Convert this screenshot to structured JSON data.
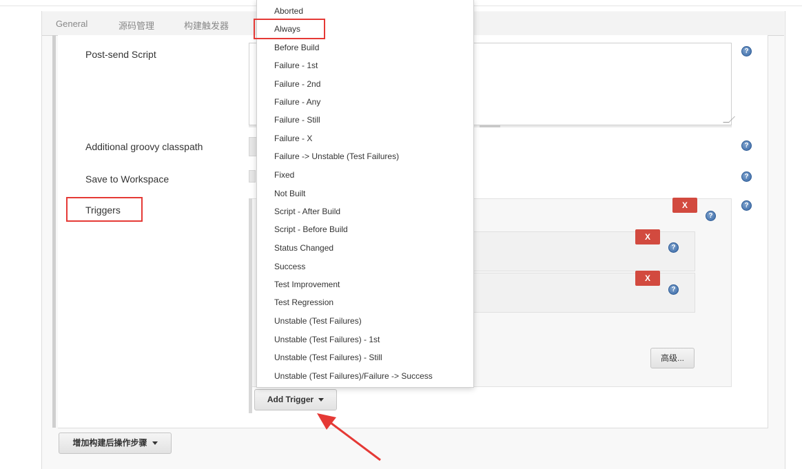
{
  "tabs": [
    "General",
    "源码管理",
    "构建触发器"
  ],
  "fields": {
    "post_send_script": "Post-send Script",
    "groovy_classpath": "Additional groovy classpath",
    "save_workspace": "Save to Workspace",
    "triggers": "Triggers"
  },
  "buttons": {
    "delete": "X",
    "advanced": "高级...",
    "add_trigger": "Add Trigger",
    "add_post_build": "增加构建后操作步骤"
  },
  "help_glyph": "?",
  "dropdown": {
    "items": [
      "Aborted",
      "Always",
      "Before Build",
      "Failure - 1st",
      "Failure - 2nd",
      "Failure - Any",
      "Failure - Still",
      "Failure - X",
      "Failure -> Unstable (Test Failures)",
      "Fixed",
      "Not Built",
      "Script - After Build",
      "Script - Before Build",
      "Status Changed",
      "Success",
      "Test Improvement",
      "Test Regression",
      "Unstable (Test Failures)",
      "Unstable (Test Failures) - 1st",
      "Unstable (Test Failures) - Still",
      "Unstable (Test Failures)/Failure -> Success"
    ]
  },
  "colors": {
    "highlight": "#e53935",
    "delete_button": "#d24a3f",
    "help_icon": "#3a6aa8",
    "annotation_arrow": "#e53935"
  }
}
